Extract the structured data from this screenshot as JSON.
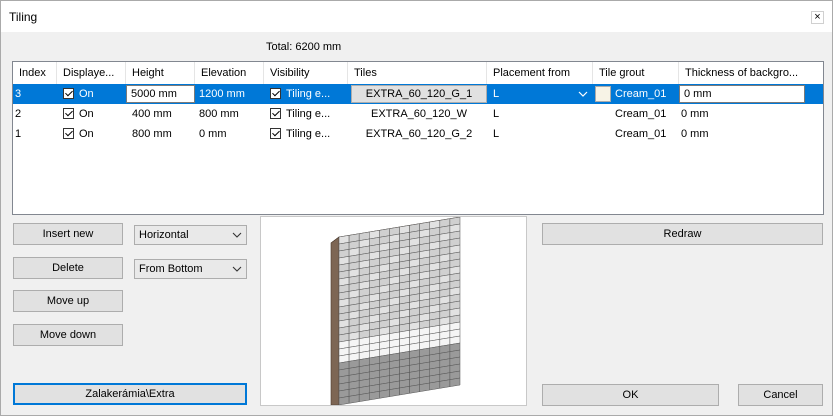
{
  "window": {
    "title": "Tiling",
    "close_glyph": "×"
  },
  "total_label": "Total: 6200 mm",
  "grid": {
    "headers": [
      "Index",
      "Displaye...",
      "Height",
      "Elevation",
      "Visibility",
      "Tiles",
      "Placement from",
      "Tile grout",
      "Thickness of backgro..."
    ],
    "rows": [
      {
        "index": "3",
        "displayed": "On",
        "height": "5000 mm",
        "elevation": "1200 mm",
        "visibility": "Tiling e...",
        "tiles": "EXTRA_60_120_G_1",
        "placement": "L",
        "grout": "Cream_01",
        "thickness": "0 mm",
        "selected": true
      },
      {
        "index": "2",
        "displayed": "On",
        "height": "400 mm",
        "elevation": "800 mm",
        "visibility": "Tiling e...",
        "tiles": "EXTRA_60_120_W",
        "placement": "L",
        "grout": "Cream_01",
        "thickness": "0 mm",
        "selected": false
      },
      {
        "index": "1",
        "displayed": "On",
        "height": "800 mm",
        "elevation": "0 mm",
        "visibility": "Tiling e...",
        "tiles": "EXTRA_60_120_G_2",
        "placement": "L",
        "grout": "Cream_01",
        "thickness": "0 mm",
        "selected": false
      }
    ]
  },
  "buttons": {
    "insert_new": "Insert new",
    "delete": "Delete",
    "move_up": "Move up",
    "move_down": "Move down",
    "library": "Zalakerámia\\Extra",
    "redraw": "Redraw",
    "ok": "OK",
    "cancel": "Cancel"
  },
  "selects": {
    "direction": "Horizontal",
    "start": "From Bottom"
  },
  "colors": {
    "selection": "#0078d7",
    "wall_frame": "#8b7360",
    "tile_dark": "#9a9a9a",
    "tile_white": "#f5f5f5",
    "tile_light": "#d0d0d0"
  }
}
